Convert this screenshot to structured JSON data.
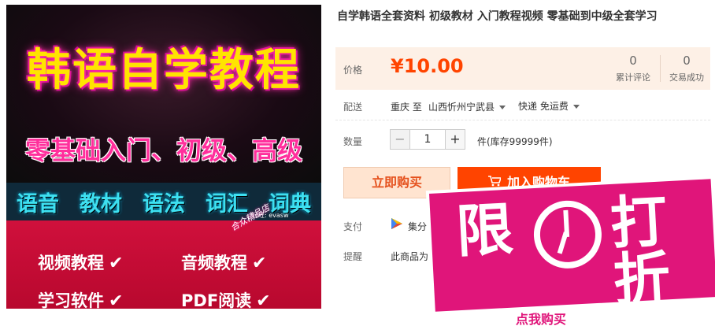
{
  "product_image": {
    "title": "韩语自学教程",
    "subtitle": "零基础入门、初级、高级",
    "band_items": [
      "语音",
      "教材",
      "语法",
      "词汇",
      "词典"
    ],
    "features": [
      "视频教程",
      "音频教程",
      "学习软件",
      "PDF阅读"
    ],
    "tick": "✔",
    "shop_name": "合众精品店",
    "signature": "旺旺: evasw"
  },
  "product": {
    "title": "自学韩语全套资料 初级教材 入门教程视频 零基础到中级全套学习"
  },
  "price": {
    "label": "价格",
    "value": "¥10.00",
    "reviews_count": "0",
    "reviews_label": "累计评论",
    "sales_count": "0",
    "sales_label": "交易成功"
  },
  "shipping": {
    "label": "配送",
    "from": "重庆 至",
    "to": "山西忻州宁武县",
    "method": "快递 免运费"
  },
  "quantity": {
    "label": "数量",
    "value": "1",
    "minus": "−",
    "plus": "+",
    "stock": "件(库存99999件)"
  },
  "actions": {
    "buy_now": "立即购买",
    "add_to_cart": "加入购物车"
  },
  "payment": {
    "label": "支付",
    "method": "集分"
  },
  "notice": {
    "label": "提醒",
    "text": "此商品为"
  },
  "promo": {
    "text_left": "限",
    "text_right": "打折",
    "bottom_text": "点我购买"
  },
  "colors": {
    "price": "#ff4400",
    "price_panel_bg": "#fdf0e6",
    "buy_now_bg": "#ffe4d0",
    "cart_bg": "#ff4400",
    "promo_bg": "#e0157a"
  }
}
